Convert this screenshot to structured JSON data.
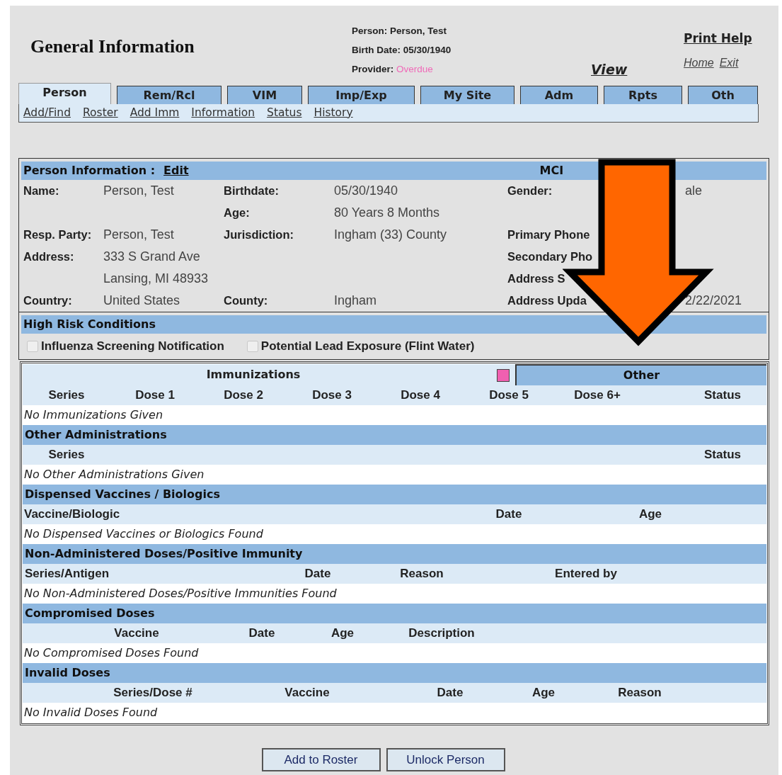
{
  "header": {
    "title": "General Information",
    "person_line": "Person: Person, Test",
    "birth_line": "Birth Date: 05/30/1940",
    "provider_label": "Provider:",
    "provider_value": "Overdue",
    "view_link": "View",
    "print_help": "Print Help",
    "home_link": "Home",
    "exit_link": "Exit"
  },
  "tabs": [
    {
      "label": "Person",
      "selected": true
    },
    {
      "label": "Rem/Rcl",
      "selected": false
    },
    {
      "label": "VIM",
      "selected": false
    },
    {
      "label": "Imp/Exp",
      "selected": false
    },
    {
      "label": "My Site",
      "selected": false
    },
    {
      "label": "Adm",
      "selected": false
    },
    {
      "label": "Rpts",
      "selected": false
    },
    {
      "label": "Oth",
      "selected": false
    }
  ],
  "subnav": [
    "Add/Find",
    "Roster",
    "Add Imm",
    "Information",
    "Status",
    "History"
  ],
  "person_info": {
    "title": "Person Information :",
    "edit_link": "Edit",
    "mci_label": "MCI",
    "rows": [
      [
        {
          "label": "Name:",
          "value": "Person, Test"
        },
        {
          "label": "Birthdate:",
          "value": "05/30/1940"
        },
        {
          "label": "Gender:",
          "value": "ale"
        }
      ],
      [
        null,
        {
          "label": "Age:",
          "value": "80 Years 8 Months"
        },
        null
      ],
      [
        {
          "label": "Resp. Party:",
          "value": "Person, Test"
        },
        {
          "label": "Jurisdiction:",
          "value": "Ingham (33) County"
        },
        {
          "label": "Primary Phone"
        }
      ],
      [
        {
          "label": "Address:",
          "value": "333 S Grand Ave"
        },
        null,
        {
          "label": "Secondary Pho"
        }
      ],
      [
        {
          "value": "Lansing, MI 48933"
        },
        null,
        {
          "label": "Address S"
        }
      ],
      [
        {
          "label": "Country:",
          "value": "United States"
        },
        {
          "label": "County:",
          "value": "Ingham"
        },
        {
          "label": "Address Upda",
          "value": "2/22/2021"
        }
      ]
    ]
  },
  "high_risk": {
    "title": "High Risk Conditions",
    "conditions": [
      {
        "label": "Influenza Screening Notification",
        "checked": false,
        "disabled": true
      },
      {
        "label": "Potential Lead Exposure (Flint Water)",
        "checked": false,
        "disabled": true
      }
    ]
  },
  "immunizations": {
    "title": "Immunizations",
    "other_tab": "Other",
    "columns": [
      "Series",
      "Dose 1",
      "Dose 2",
      "Dose 3",
      "Dose 4",
      "Dose 5",
      "Dose 6+",
      "Status"
    ],
    "empty_message": "No Immunizations Given"
  },
  "sections": [
    {
      "title": "Other Administrations",
      "columns": [
        "Series",
        "Status"
      ],
      "empty_message": "No Other Administrations Given"
    },
    {
      "title": "Dispensed Vaccines / Biologics",
      "columns": [
        "Vaccine/Biologic",
        "Date",
        "Age"
      ],
      "empty_message": "No Dispensed Vaccines or Biologics Found"
    },
    {
      "title": "Non-Administered Doses/Positive Immunity",
      "columns": [
        "Series/Antigen",
        "Date",
        "Reason",
        "Entered by"
      ],
      "empty_message": "No Non-Administered Doses/Positive Immunities Found"
    },
    {
      "title": "Compromised Doses",
      "columns": [
        "Vaccine",
        "Date",
        "Age",
        "Description"
      ],
      "empty_message": "No Compromised Doses Found"
    },
    {
      "title": "Invalid Doses",
      "columns": [
        "Series/Dose #",
        "Vaccine",
        "Date",
        "Age",
        "Reason"
      ],
      "empty_message": "No Invalid Doses Found"
    }
  ],
  "buttons": [
    "Add to Roster",
    "Unlock Person"
  ]
}
